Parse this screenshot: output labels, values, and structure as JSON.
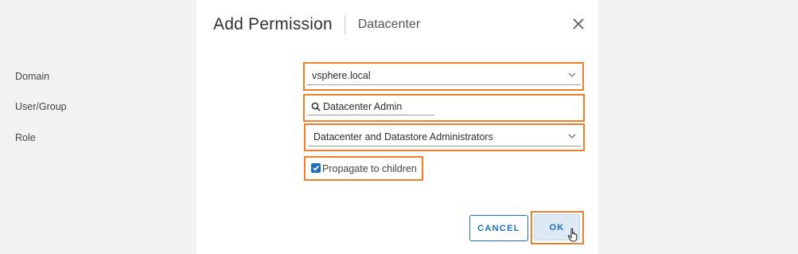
{
  "dialog": {
    "title": "Add Permission",
    "subtitle": "Datacenter"
  },
  "form": {
    "domain": {
      "label": "Domain",
      "value": "vsphere.local"
    },
    "user_group": {
      "label": "User/Group",
      "value": "Datacenter Admin"
    },
    "role": {
      "label": "Role",
      "value": "Datacenter and Datastore Administrators"
    },
    "propagate": {
      "label": "Propagate to children",
      "checked": true
    }
  },
  "buttons": {
    "cancel": "CANCEL",
    "ok": "OK"
  },
  "colors": {
    "highlight": "#ef7f2c",
    "accent": "#1f6fbf",
    "ok_background": "#dde9f5"
  },
  "icons": [
    "close-icon",
    "chevron-down-icon",
    "search-icon",
    "checkmark-icon",
    "hand-cursor-icon"
  ]
}
